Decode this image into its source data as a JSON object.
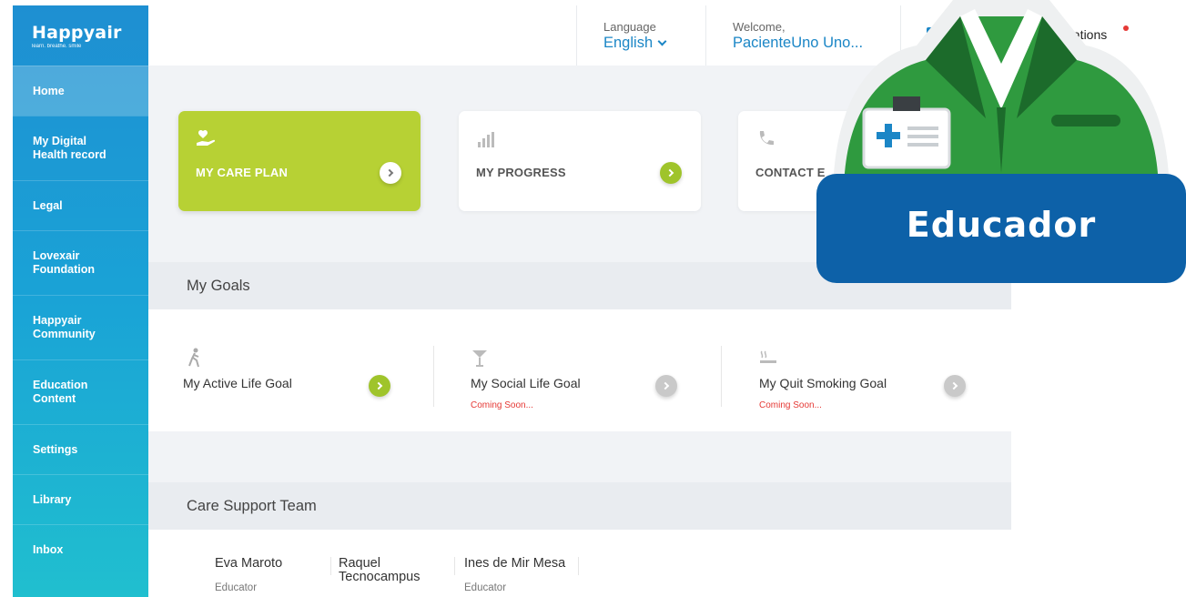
{
  "brand": {
    "name": "Happyair",
    "tagline": "learn. breathe. smile"
  },
  "sidebar": {
    "items": [
      {
        "label": "Home",
        "active": true
      },
      {
        "label": "My Digital Health record"
      },
      {
        "label": "Legal"
      },
      {
        "label": "Lovexair Foundation"
      },
      {
        "label": "Happyair Community"
      },
      {
        "label": "Education Content"
      },
      {
        "label": "Settings"
      },
      {
        "label": "Library"
      },
      {
        "label": "Inbox"
      }
    ]
  },
  "topbar": {
    "language_label": "Language",
    "language_value": "English",
    "welcome_label": "Welcome,",
    "welcome_user": "PacienteUno Uno...",
    "notifications_label": "Notifications"
  },
  "cards": [
    {
      "label": "MY CARE PLAN",
      "icon": "heart-hand-icon"
    },
    {
      "label": "MY PROGRESS",
      "icon": "bar-chart-icon"
    },
    {
      "label": "CONTACT E",
      "icon": "phone-icon"
    }
  ],
  "goals": {
    "title": "My Goals",
    "items": [
      {
        "label": "My Active Life Goal",
        "status": "",
        "icon": "walking-person-icon",
        "enabled": true
      },
      {
        "label": "My Social Life Goal",
        "status": "Coming Soon...",
        "icon": "cocktail-icon",
        "enabled": false
      },
      {
        "label": "My Quit Smoking Goal",
        "status": "Coming Soon...",
        "icon": "cigarette-icon",
        "enabled": false
      }
    ]
  },
  "team": {
    "title": "Care Support Team",
    "members": [
      {
        "name": "Eva Maroto",
        "role": "Educator"
      },
      {
        "name": "Raquel Tecnocampus",
        "role": ""
      },
      {
        "name": "Ines de Mir Mesa",
        "role": "Educator"
      }
    ]
  },
  "overlay": {
    "label": "Educador"
  },
  "colors": {
    "primary": "#1b86c6",
    "accent_green": "#b7d134",
    "badge_blue": "#0d61a8",
    "badge_green": "#2e9b3d",
    "alert_red": "#e53935"
  }
}
